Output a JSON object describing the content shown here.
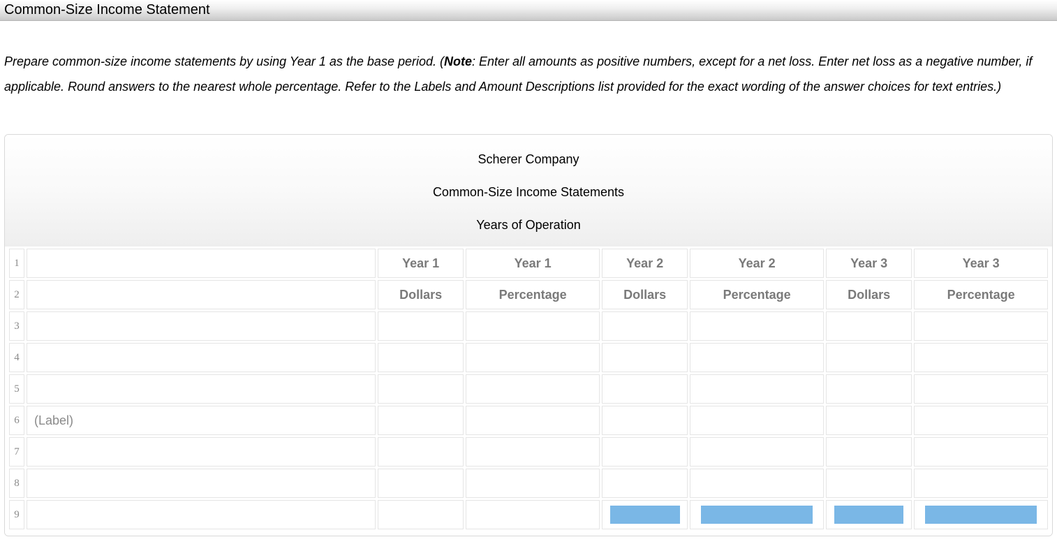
{
  "titlebar": "Common-Size Income Statement",
  "instructions": {
    "pre": "Prepare common-size income statements by using Year 1 as the base period. (",
    "note_label": "Note",
    "post": ": Enter all amounts as positive numbers, except for a net loss. Enter net loss as a negative number, if applicable. Round answers to the nearest whole percentage. Refer to the Labels and Amount Descriptions list provided for the exact wording of the answer choices for text entries.)"
  },
  "sheet": {
    "company": "Scherer Company",
    "title": "Common-Size Income Statements",
    "subtitle": "Years of Operation",
    "header_row1": [
      "Year 1",
      "Year 1",
      "Year 2",
      "Year 2",
      "Year 3",
      "Year 3"
    ],
    "header_row2": [
      "Dollars",
      "Percentage",
      "Dollars",
      "Percentage",
      "Dollars",
      "Percentage"
    ],
    "rows": [
      {
        "num": "1",
        "desc": ""
      },
      {
        "num": "2",
        "desc": ""
      },
      {
        "num": "3",
        "desc": ""
      },
      {
        "num": "4",
        "desc": ""
      },
      {
        "num": "5",
        "desc": ""
      },
      {
        "num": "6",
        "desc": "(Label)"
      },
      {
        "num": "7",
        "desc": ""
      },
      {
        "num": "8",
        "desc": ""
      },
      {
        "num": "9",
        "desc": ""
      }
    ],
    "highlight_row_index": 8,
    "highlight_cols": [
      2,
      3,
      4,
      5
    ]
  }
}
